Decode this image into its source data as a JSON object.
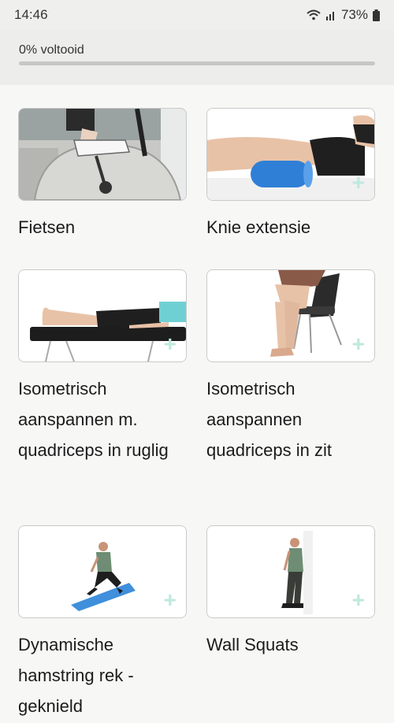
{
  "status": {
    "time": "14:46",
    "battery": "73%"
  },
  "progress": {
    "label": "0% voltooid",
    "percent": 0,
    "fill_color": "#5aa6a0"
  },
  "exercises": [
    {
      "title": "Fietsen",
      "icon": "cycling-exercise-icon"
    },
    {
      "title": "Knie extensie",
      "icon": "knee-extension-exercise-icon"
    },
    {
      "title": "Isometrisch aanspannen m. quadriceps in ruglig",
      "icon": "supine-quadriceps-exercise-icon"
    },
    {
      "title": "Isometrisch aanspannen quadriceps in zit",
      "icon": "seated-quadriceps-exercise-icon"
    },
    {
      "title": "Dynamische hamstring rek - geknield",
      "icon": "kneeling-hamstring-stretch-icon"
    },
    {
      "title": "Wall Squats",
      "icon": "wall-squat-icon"
    }
  ],
  "add_icon": "+"
}
